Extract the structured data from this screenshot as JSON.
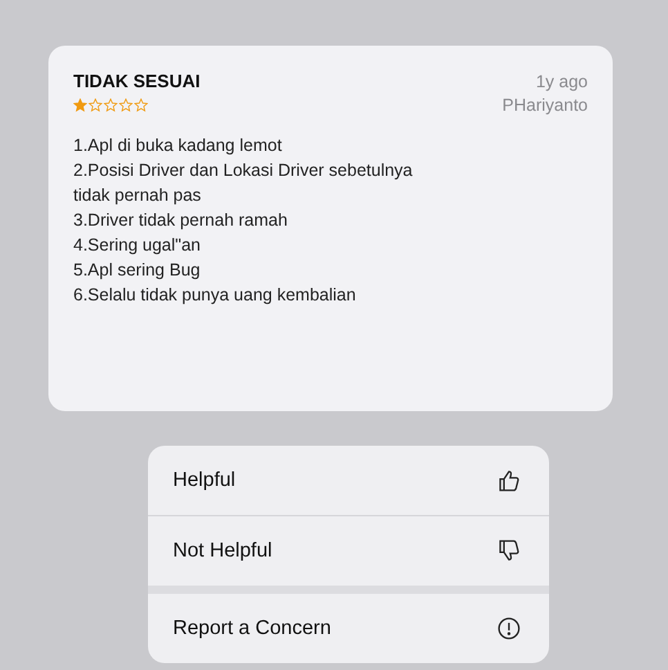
{
  "review": {
    "title": "TIDAK SESUAI",
    "time": "1y ago",
    "stars": 1,
    "author": "PHariyanto",
    "lines": [
      "1.Apl di buka kadang lemot",
      "2.Posisi Driver dan Lokasi Driver sebetulnya tidak pernah pas",
      "3.Driver tidak pernah ramah",
      "4.Sering ugal\"an",
      "5.Apl sering Bug",
      "6.Selalu tidak punya uang kembalian"
    ]
  },
  "menu": {
    "groups": [
      [
        {
          "label": "Helpful",
          "kind": "thumbs-up"
        },
        {
          "label": "Not Helpful",
          "kind": "thumbs-down"
        }
      ],
      [
        {
          "label": "Report a Concern",
          "kind": "info"
        }
      ]
    ]
  }
}
